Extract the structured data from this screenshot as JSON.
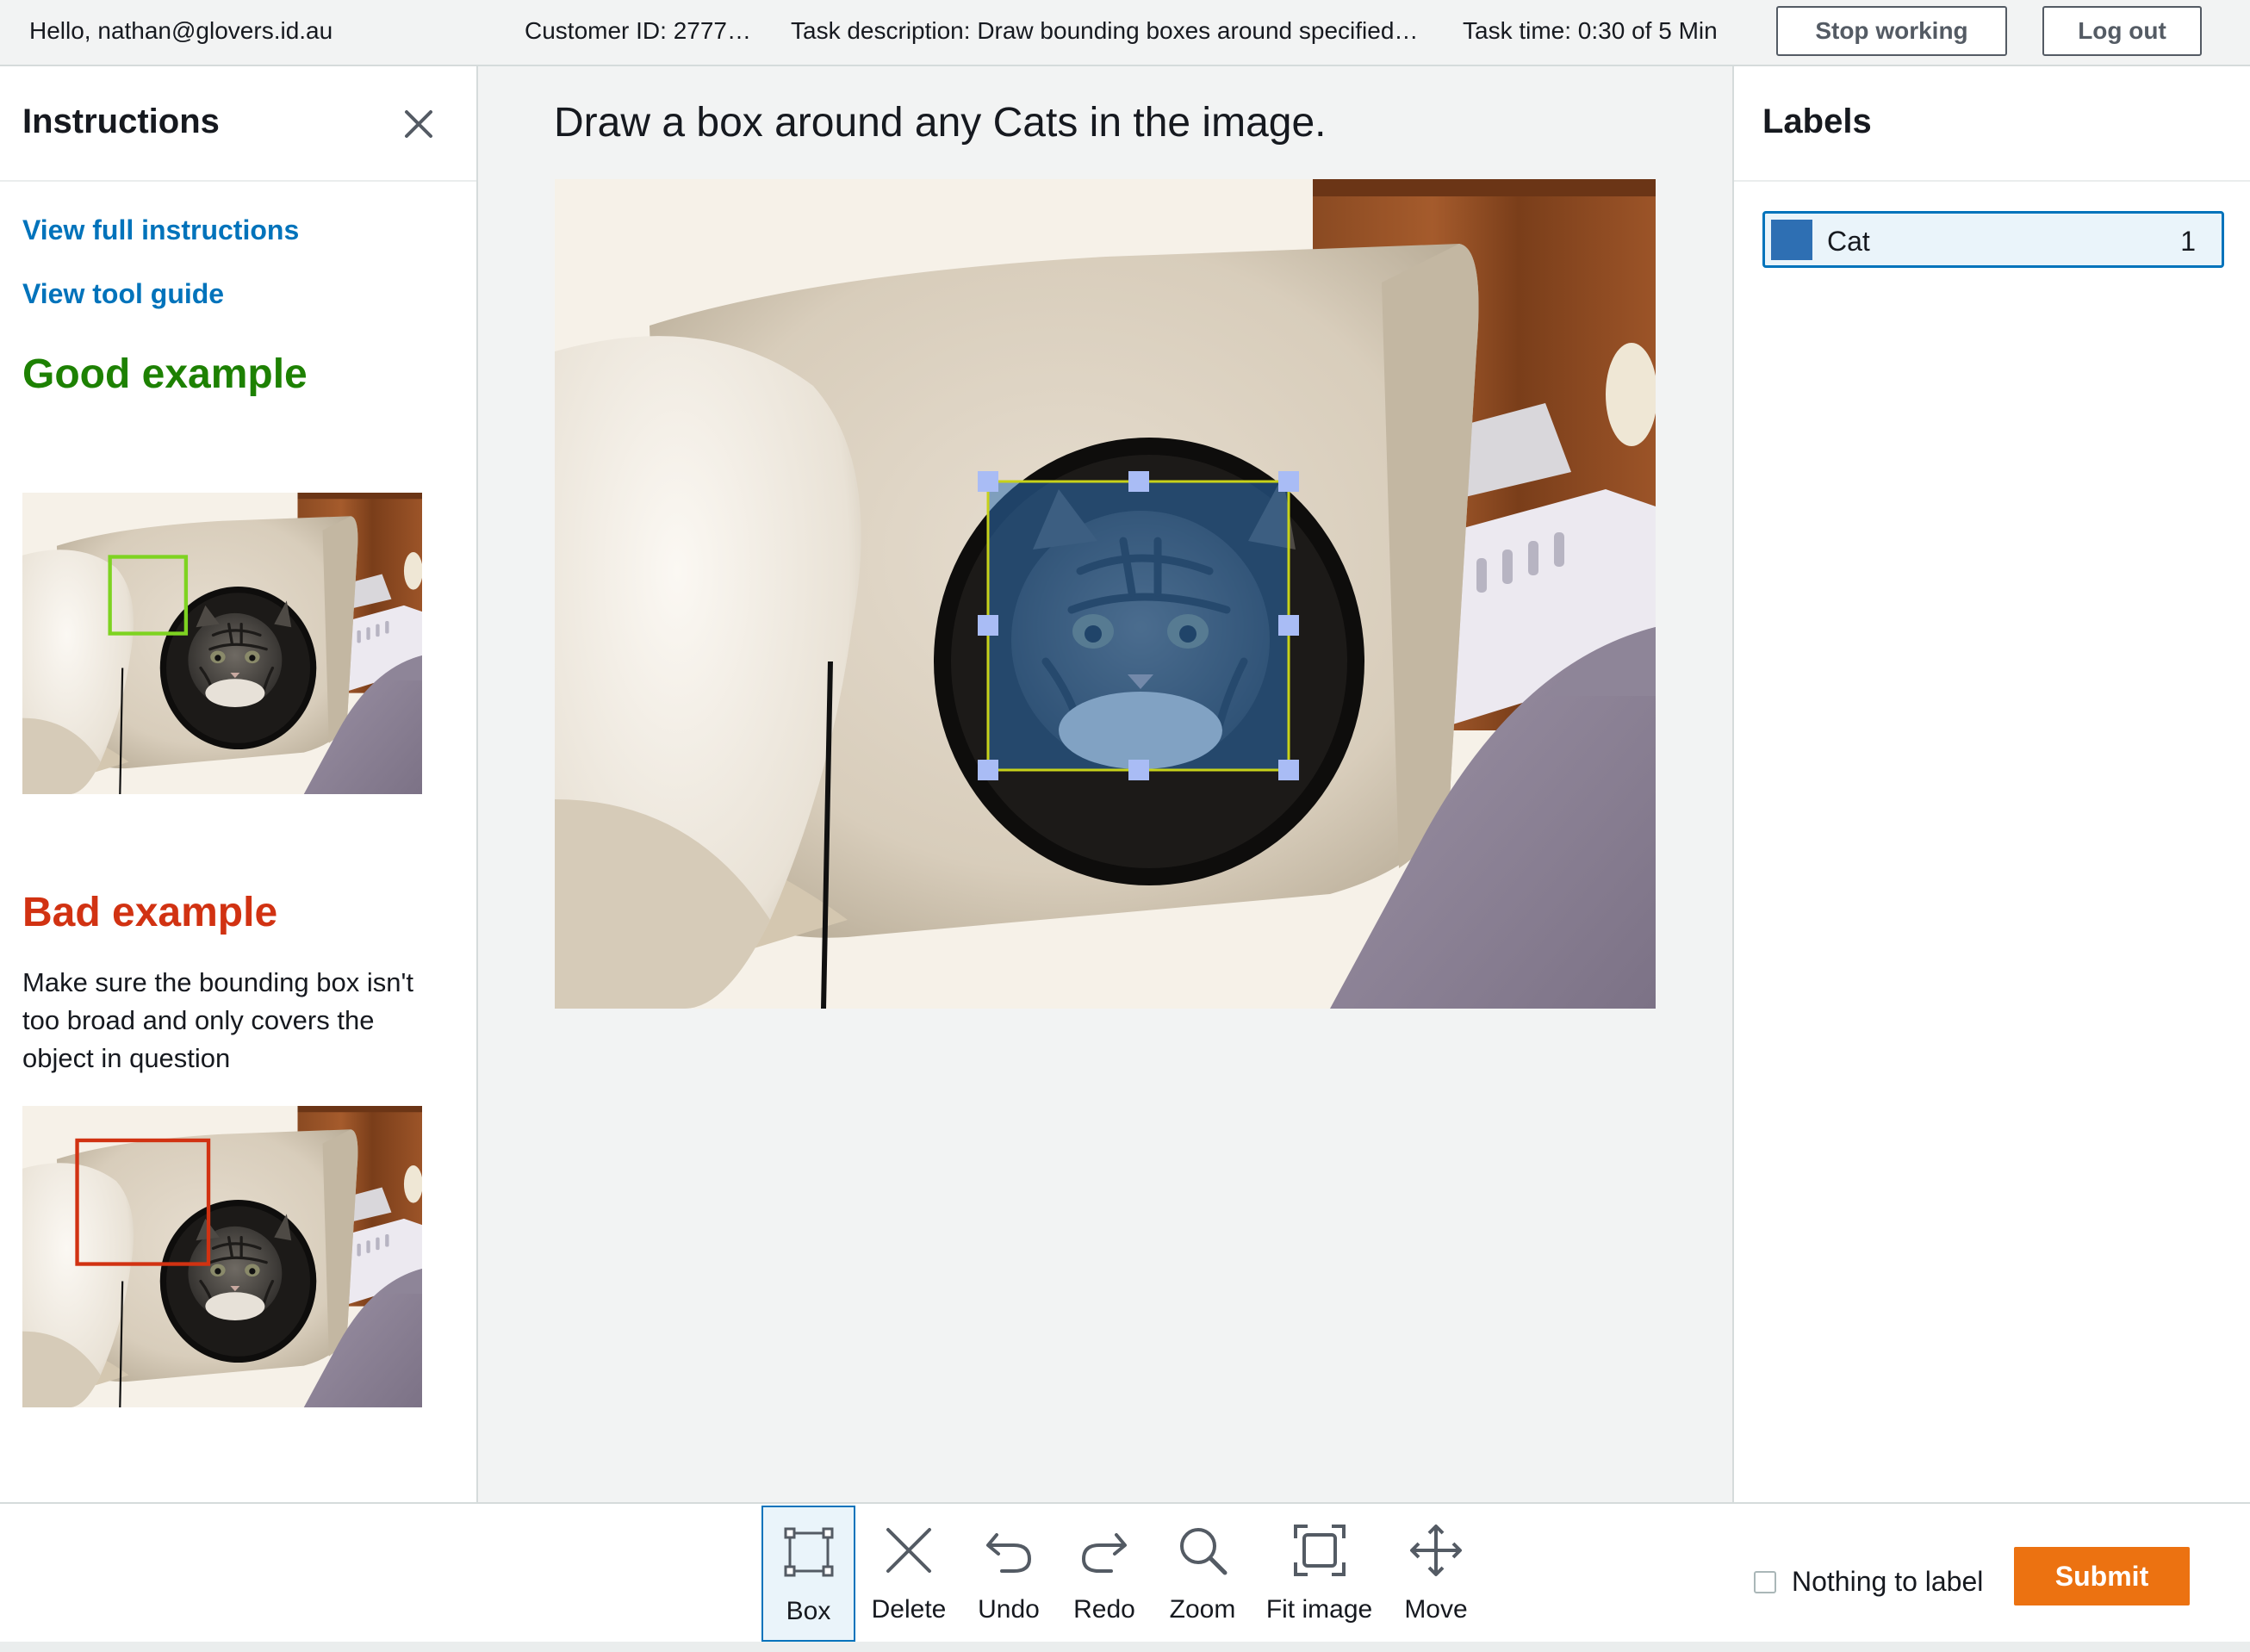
{
  "header": {
    "greeting": "Hello, nathan@glovers.id.au",
    "customer_id": "Customer ID: 2777…",
    "task_description": "Task description: Draw bounding boxes around specified…",
    "task_time": "Task time: 0:30 of 5 Min",
    "stop_label": "Stop working",
    "logout_label": "Log out"
  },
  "instructions": {
    "title": "Instructions",
    "close_icon": "close-icon",
    "links": [
      "View full instructions",
      "View tool guide"
    ],
    "good_heading": "Good example",
    "bad_heading": "Bad example",
    "bad_description": "Make sure the bounding box isn't too broad and only covers the object in question",
    "good_box_color": "#7ed321",
    "bad_box_color": "#d13212"
  },
  "main": {
    "prompt": "Draw a box around any Cats in the image.",
    "box_outline_color": "#c7d21a",
    "box_fill_color": "#2e6fb3",
    "handle_color": "#a9bcf5"
  },
  "labels": {
    "title": "Labels",
    "items": [
      {
        "name": "Cat",
        "count": "1",
        "color": "#2e6fb3"
      }
    ]
  },
  "toolbar": {
    "tools": [
      {
        "label": "Box",
        "icon": "box-icon",
        "active": true
      },
      {
        "label": "Delete",
        "icon": "delete-icon"
      },
      {
        "label": "Undo",
        "icon": "undo-icon"
      },
      {
        "label": "Redo",
        "icon": "redo-icon"
      },
      {
        "label": "Zoom",
        "icon": "zoom-icon"
      },
      {
        "label": "Fit image",
        "icon": "fit-image-icon"
      },
      {
        "label": "Move",
        "icon": "move-icon"
      }
    ],
    "nothing_to_label": "Nothing to label",
    "submit_label": "Submit",
    "submit_color": "#ec7211"
  }
}
